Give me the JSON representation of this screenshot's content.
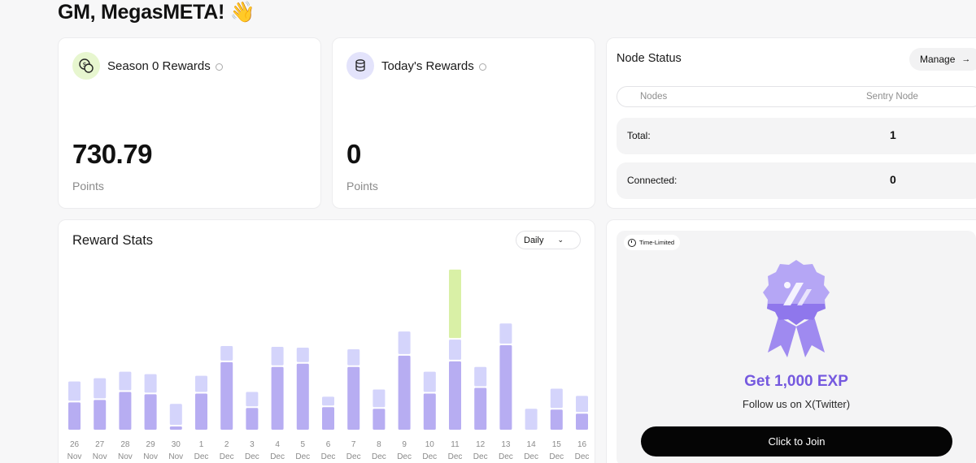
{
  "header": {
    "greeting": "GM, MegasMETA! 👋"
  },
  "season_card": {
    "title": "Season 0 Rewards",
    "value": "730.79",
    "unit": "Points",
    "icon": "coins-icon"
  },
  "today_card": {
    "title": "Today's Rewards",
    "value": "0",
    "unit": "Points",
    "icon": "coin-stack-icon"
  },
  "node_status": {
    "title": "Node Status",
    "manage_label": "Manage",
    "tabs": [
      "Nodes",
      "Sentry Node"
    ],
    "total_label": "Total:",
    "total_value": "1",
    "connected_label": "Connected:",
    "connected_value": "0"
  },
  "reward_stats": {
    "title": "Reward Stats",
    "period": "Daily"
  },
  "promo": {
    "badge": "Time-Limited",
    "title": "Get 1,000 EXP",
    "subtitle": "Follow us on X(Twitter)",
    "button": "Click to Join"
  },
  "colors": {
    "bar_main": "#b7adf2",
    "bar_top": "#d4d4fb",
    "bar_special": "#d9f0a6",
    "accent": "#7559df"
  },
  "chart_data": {
    "type": "bar",
    "categories": [
      "26 Nov",
      "27 Nov",
      "28 Nov",
      "29 Nov",
      "30 Nov",
      "1 Dec",
      "2 Dec",
      "3 Dec",
      "4 Dec",
      "5 Dec",
      "6 Dec",
      "7 Dec",
      "8 Dec",
      "9 Dec",
      "10 Dec",
      "11 Dec",
      "12 Dec",
      "13 Dec",
      "14 Dec",
      "15 Dec",
      "16 Dec"
    ],
    "tick_labels": [
      [
        "26",
        "Nov"
      ],
      [
        "27",
        "Nov"
      ],
      [
        "28",
        "Nov"
      ],
      [
        "29",
        "Nov"
      ],
      [
        "30",
        "Nov"
      ],
      [
        "1",
        "Dec"
      ],
      [
        "2",
        "Dec"
      ],
      [
        "3",
        "Dec"
      ],
      [
        "4",
        "Dec"
      ],
      [
        "5",
        "Dec"
      ],
      [
        "6",
        "Dec"
      ],
      [
        "7",
        "Dec"
      ],
      [
        "8",
        "Dec"
      ],
      [
        "9",
        "Dec"
      ],
      [
        "10",
        "Dec"
      ],
      [
        "11",
        "Dec"
      ],
      [
        "12",
        "Dec"
      ],
      [
        "13",
        "Dec"
      ],
      [
        "14",
        "Dec"
      ],
      [
        "15",
        "Dec"
      ],
      [
        "16",
        "Dec"
      ]
    ],
    "series": [
      {
        "values": [
          34,
          37,
          47,
          44,
          4,
          45,
          84,
          27,
          78,
          82,
          28,
          78,
          26,
          92,
          45,
          85,
          52,
          105,
          0,
          25,
          20
        ]
      },
      {
        "values": [
          24,
          25,
          23,
          23,
          26,
          20,
          18,
          18,
          23,
          18,
          11,
          20,
          22,
          28,
          25,
          25,
          24,
          25,
          26,
          24,
          20
        ]
      },
      {
        "values": [
          0,
          0,
          0,
          0,
          0,
          0,
          0,
          0,
          0,
          0,
          0,
          0,
          0,
          0,
          0,
          85,
          0,
          0,
          0,
          0,
          0
        ]
      }
    ],
    "ylim": [
      0,
      205
    ],
    "grid": false
  }
}
